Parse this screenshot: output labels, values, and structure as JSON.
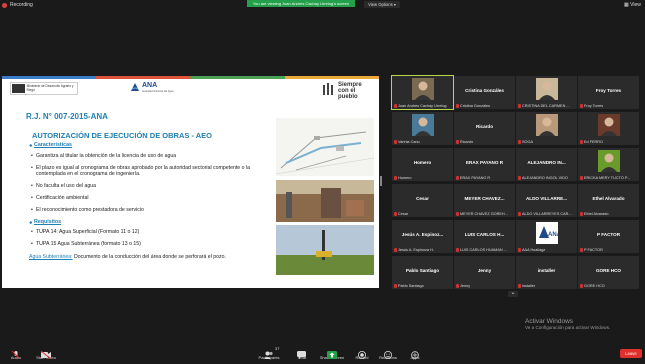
{
  "top": {
    "recording": "Recording",
    "banner": "You are viewing Juan Andres Cachay Urrelog's screen",
    "view_options": "View Options",
    "view": "View"
  },
  "slide": {
    "logo_ministry": "Ministerio de Desarrollo Agrario y Riego",
    "logo_ana": "ANA",
    "logo_ana_sub": "Autoridad Nacional del Agua",
    "logo_siempre": "Siempre con el pueblo",
    "title": "R.J. N° 007-2015-ANA",
    "heading": "AUTORIZACIÓN DE EJECUCIÓN DE OBRAS - AEO",
    "sec1": "Características",
    "bullets1": [
      "Garantiza al titular la obtención de la licencia de uso de agua",
      "El plazo es igual al cronograma de obras aprobado por la autoridad sectorial competente o la contemplada en el cronograma de ingeniería.",
      "No faculta el uso del agua",
      "Certificación ambiental",
      "El reconocimiento como prestadora de servicio"
    ],
    "sec2": "Requisitos",
    "bullets2": [
      "TUPA 14: Agua Superficial (Formato 11 o 12)",
      "TUPA 15 Agua Subterránea (formato 13 o 15)"
    ],
    "note_label": "Agua Subterránea:",
    "note_text": " Documento de la conducción del área donde se perforará el pozo."
  },
  "gallery": [
    {
      "name": "",
      "label": "Juan Andres Cachay Urrelog",
      "pic": "person"
    },
    {
      "name": "Cristina Gonzáles",
      "label": "Cristina Gonzáles"
    },
    {
      "name": "",
      "label": "CRISTINA DEL CARMEN ...",
      "pic": "person2"
    },
    {
      "name": "Froy Torres",
      "label": "Froy Torres"
    },
    {
      "name": "",
      "label": "Varinia Cano",
      "pic": "person3"
    },
    {
      "name": "Ricardo",
      "label": "Ricardo"
    },
    {
      "name": "",
      "label": "SOGA",
      "pic": "person4"
    },
    {
      "name": "",
      "label": "Ed FERRO",
      "pic": "person5"
    },
    {
      "name": "Homero",
      "label": "Homero"
    },
    {
      "name": "ERAX PAYANO R",
      "label": "ERAX PAYANO R"
    },
    {
      "name": "ALEJANDRO IN...",
      "label": "ALEJANDRO INGOL VIDO"
    },
    {
      "name": "",
      "label": "ERICKA MERY TUCTO P...",
      "pic": "flower"
    },
    {
      "name": "Cesar",
      "label": "Cesar"
    },
    {
      "name": "MEYER CHAVEZ...",
      "label": "MEYER CHAVEZ GOREH..."
    },
    {
      "name": "ALDO VILLARRE...",
      "label": "ALDO VILLARREYES CAR..."
    },
    {
      "name": "Ethel Alvarado",
      "label": "Ethel Alvarado"
    },
    {
      "name": "Jesús A. Espinoz...",
      "label": "Jesús A. Espinoza H."
    },
    {
      "name": "LUIS CARLOS H...",
      "label": "LUIS CARLOS HUAMAN ..."
    },
    {
      "name": "",
      "label": "AAA Huallaga",
      "pic": "ana"
    },
    {
      "name": "P FACTOR",
      "label": "P FACTOR"
    },
    {
      "name": "Pablo Santiago",
      "label": "Pablo Santiago"
    },
    {
      "name": "Jenny",
      "label": "Jenny"
    },
    {
      "name": "installer",
      "label": "installer"
    },
    {
      "name": "GORE HCO",
      "label": "GORE HCO"
    }
  ],
  "watermark": {
    "title": "Activar Windows",
    "subtitle": "Ve a Configuración para activar Windows."
  },
  "toolbar": {
    "audio": "Audio",
    "start_video": "Start Video",
    "participants": "Participants",
    "participants_count": "37",
    "chat": "Chat",
    "share_screen": "Share Screen",
    "record": "Record",
    "reactions": "Reactions",
    "apps": "Apps",
    "leave": "Leave"
  }
}
